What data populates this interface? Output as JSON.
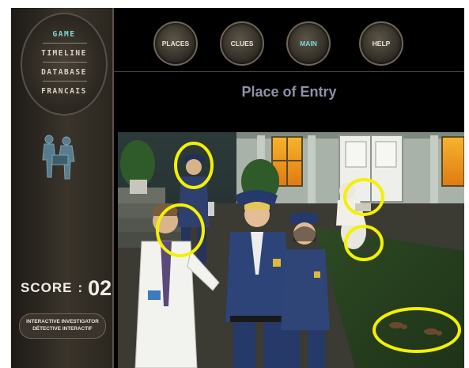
{
  "sidebar": {
    "menu": [
      {
        "label": "GAME",
        "active": true
      },
      {
        "label": "TIMELINE",
        "active": false
      },
      {
        "label": "DATABASE",
        "active": false
      },
      {
        "label": "FRANCAIS",
        "active": false
      }
    ],
    "score_label": "SCORE",
    "score_separator": ":",
    "score_value": "02",
    "brand_line1": "INTERACTIVE INVESTIGATOR",
    "brand_line2": "DÉTECTIVE INTERACTIF"
  },
  "nav": {
    "places": "PLACES",
    "clues": "CLUES",
    "main": "MAIN",
    "help": "HELP",
    "active": "MAIN"
  },
  "page": {
    "title": "Place of Entry"
  },
  "scene": {
    "description_icons": [
      "police-officer-icon",
      "lab-coat-man-icon",
      "detective-icon",
      "female-officer-icon",
      "forensic-tech-icon",
      "footprint-icon"
    ],
    "highlight_color": "#f4f000",
    "colors": {
      "active_menu": "#7fd6d8",
      "title": "#8c93a8",
      "window_glow": "#f0a020"
    }
  }
}
